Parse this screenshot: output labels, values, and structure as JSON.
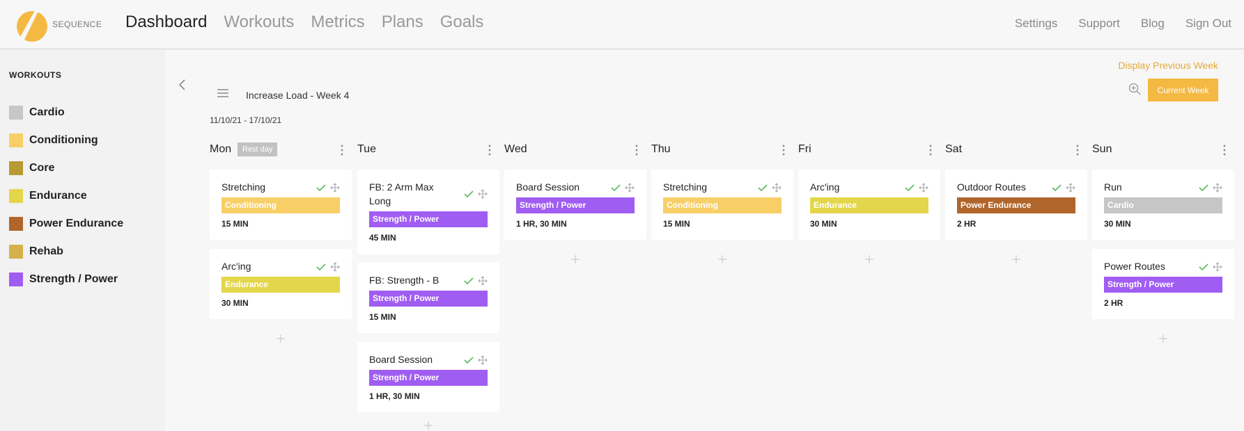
{
  "brand": {
    "name": "SEQUENCE"
  },
  "nav": {
    "items": [
      "Dashboard",
      "Workouts",
      "Metrics",
      "Plans",
      "Goals"
    ]
  },
  "right_nav": {
    "items": [
      "Settings",
      "Support",
      "Blog",
      "Sign Out"
    ]
  },
  "sidebar": {
    "title": "WORKOUTS",
    "categories": [
      {
        "label": "Cardio",
        "color": "#c6c6c6"
      },
      {
        "label": "Conditioning",
        "color": "#f8cf67"
      },
      {
        "label": "Core",
        "color": "#b89a33"
      },
      {
        "label": "Endurance",
        "color": "#e3d64a"
      },
      {
        "label": "Power Endurance",
        "color": "#b1652a"
      },
      {
        "label": "Rehab",
        "color": "#d4b14a"
      },
      {
        "label": "Strength / Power",
        "color": "#a05df2"
      }
    ]
  },
  "plan": {
    "title": "Increase Load - Week 4",
    "date_range": "11/10/21 - 17/10/21",
    "prev_week_label": "Display Previous Week",
    "current_week_label": "Current Week"
  },
  "days": [
    {
      "name": "Mon",
      "badge": "Rest day",
      "workouts": [
        {
          "title": "Stretching",
          "category": "Conditioning",
          "duration": "15 MIN"
        },
        {
          "title": "Arc'ing",
          "category": "Endurance",
          "duration": "30 MIN"
        }
      ]
    },
    {
      "name": "Tue",
      "workouts": [
        {
          "title": "FB: 2 Arm Max Long",
          "category": "Strength / Power",
          "duration": "45 MIN"
        },
        {
          "title": "FB: Strength - B",
          "category": "Strength / Power",
          "duration": "15 MIN"
        },
        {
          "title": "Board Session",
          "category": "Strength / Power",
          "duration": "1 HR, 30 MIN"
        }
      ]
    },
    {
      "name": "Wed",
      "workouts": [
        {
          "title": "Board Session",
          "category": "Strength / Power",
          "duration": "1 HR, 30 MIN"
        }
      ]
    },
    {
      "name": "Thu",
      "workouts": [
        {
          "title": "Stretching",
          "category": "Conditioning",
          "duration": "15 MIN"
        }
      ]
    },
    {
      "name": "Fri",
      "workouts": [
        {
          "title": "Arc'ing",
          "category": "Endurance",
          "duration": "30 MIN"
        }
      ]
    },
    {
      "name": "Sat",
      "workouts": [
        {
          "title": "Outdoor Routes",
          "category": "Power Endurance",
          "duration": "2 HR"
        }
      ]
    },
    {
      "name": "Sun",
      "workouts": [
        {
          "title": "Run",
          "category": "Cardio",
          "duration": "30 MIN"
        },
        {
          "title": "Power Routes",
          "category": "Strength / Power",
          "duration": "2 HR"
        }
      ]
    }
  ],
  "colors": {
    "accent": "#f4b942",
    "check": "#5cb85c"
  },
  "icons": {
    "logo": "sequence-logo",
    "back": "chevron-left-icon",
    "menu": "hamburger-menu-icon",
    "zoom": "zoom-in-icon",
    "more": "more-vertical-icon",
    "complete": "check-icon",
    "move": "move-icon",
    "add": "plus-icon"
  }
}
